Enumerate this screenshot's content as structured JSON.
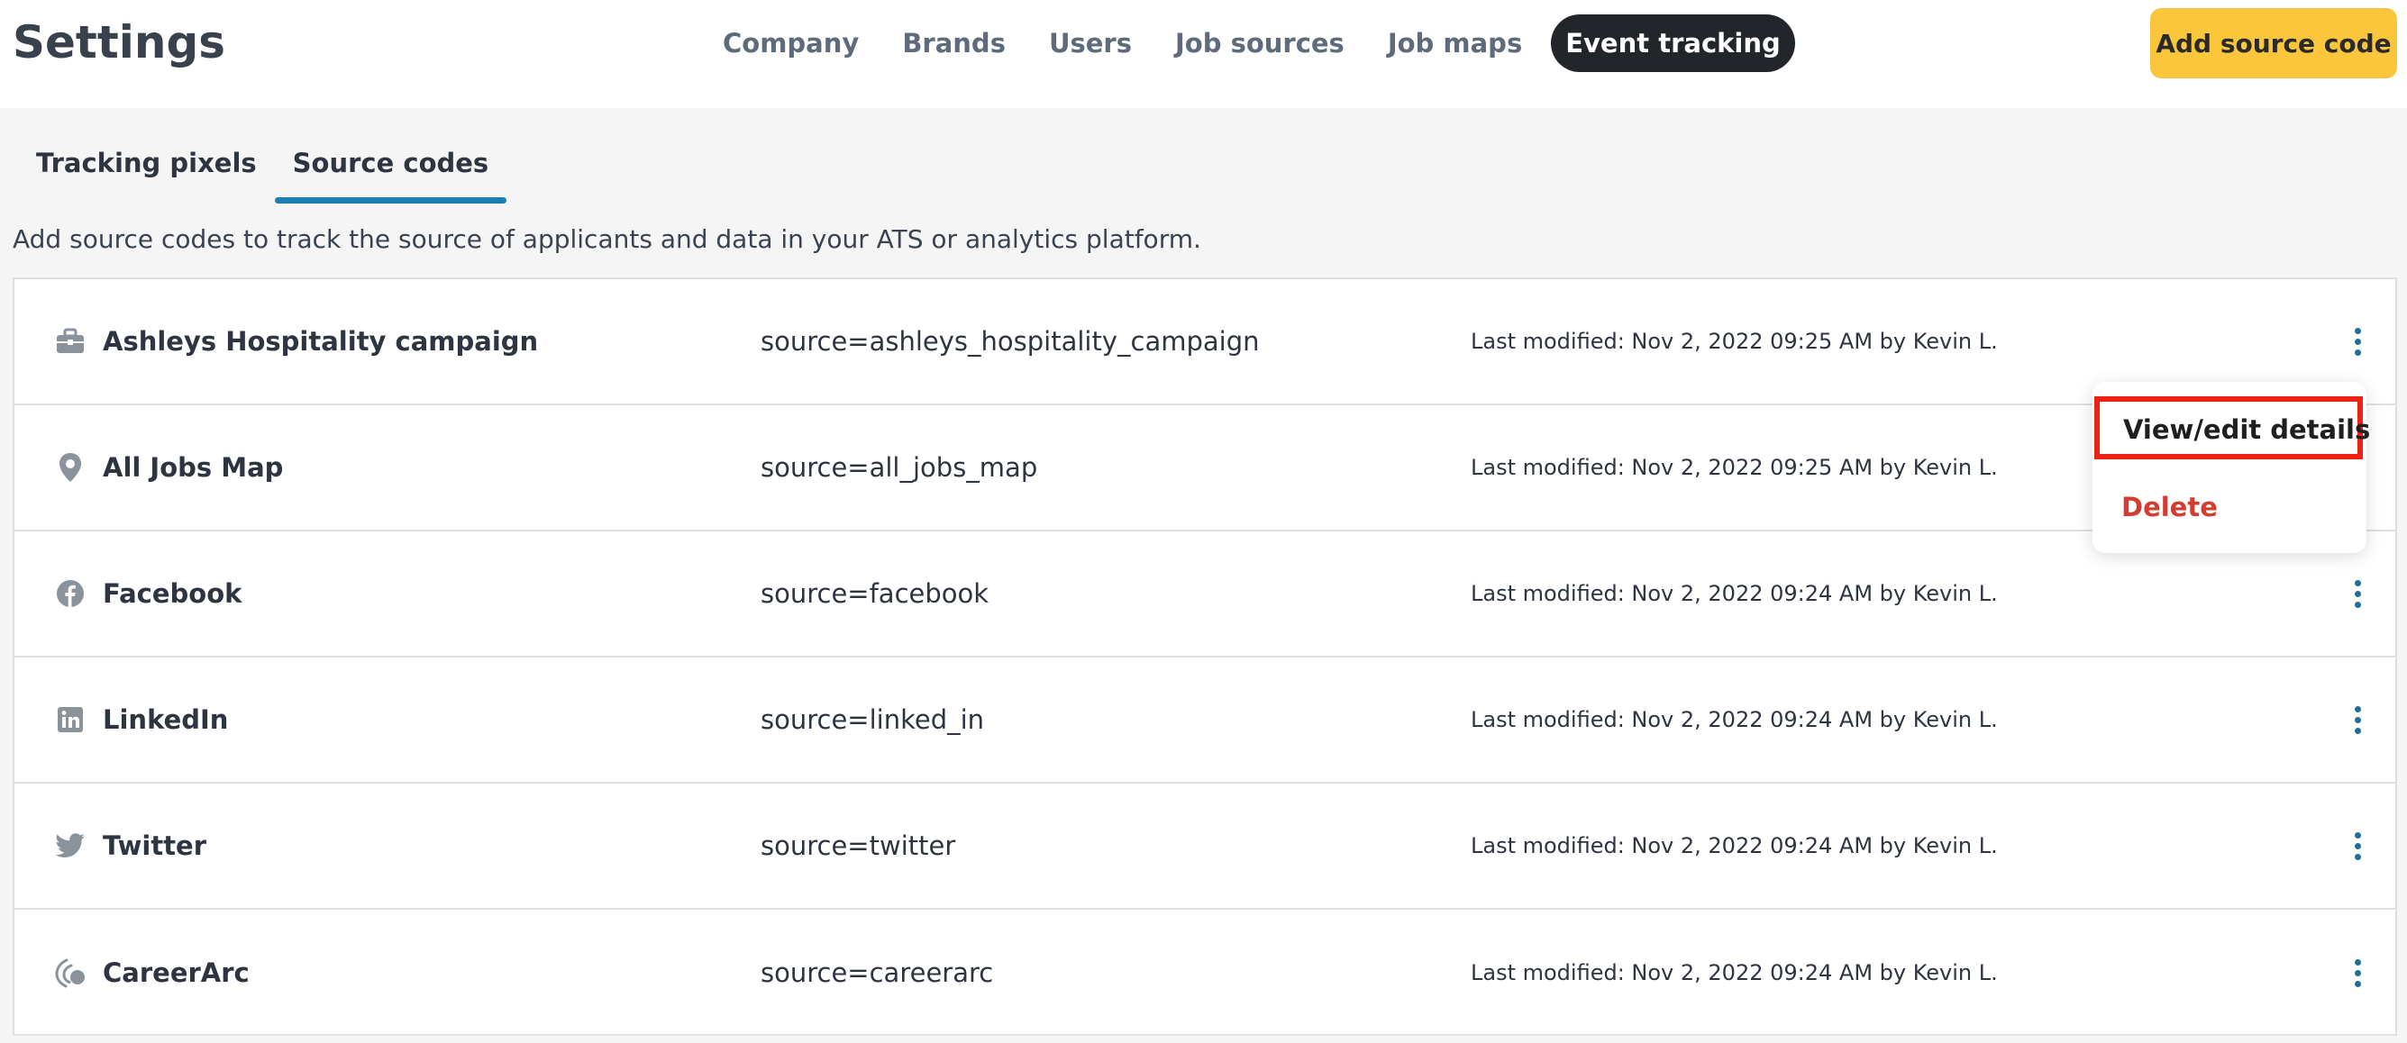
{
  "header": {
    "title": "Settings",
    "nav": [
      "Company",
      "Brands",
      "Users",
      "Job sources",
      "Job maps",
      "Event tracking"
    ],
    "active_nav": "Event tracking",
    "add_button": "Add source code"
  },
  "subtabs": [
    "Tracking pixels",
    "Source codes"
  ],
  "active_subtab": "Source codes",
  "description": "Add source codes to track the source of applicants and data in your ATS or analytics platform.",
  "rows": [
    {
      "icon": "briefcase-icon",
      "name": "Ashleys Hospitality campaign",
      "code": "source=ashleys_hospitality_campaign",
      "modified": "Last modified: Nov 2, 2022 09:25 AM by Kevin L."
    },
    {
      "icon": "map-pin-icon",
      "name": "All Jobs Map",
      "code": "source=all_jobs_map",
      "modified": "Last modified: Nov 2, 2022 09:25 AM by Kevin L."
    },
    {
      "icon": "facebook-icon",
      "name": "Facebook",
      "code": "source=facebook",
      "modified": "Last modified: Nov 2, 2022 09:24 AM by Kevin L."
    },
    {
      "icon": "linkedin-icon",
      "name": "LinkedIn",
      "code": "source=linked_in",
      "modified": "Last modified: Nov 2, 2022 09:24 AM by Kevin L."
    },
    {
      "icon": "twitter-icon",
      "name": "Twitter",
      "code": "source=twitter",
      "modified": "Last modified: Nov 2, 2022 09:24 AM by Kevin L."
    },
    {
      "icon": "careerarc-icon",
      "name": "CareerArc",
      "code": "source=careerarc",
      "modified": "Last modified: Nov 2, 2022 09:24 AM by Kevin L."
    }
  ],
  "menu": {
    "view_edit": "View/edit details",
    "delete": "Delete"
  },
  "colors": {
    "accent": "#1b7fb3",
    "add_button": "#fbc53c",
    "active_nav": "#22262b",
    "delete": "#d53b2e",
    "highlight": "#ee2213"
  }
}
